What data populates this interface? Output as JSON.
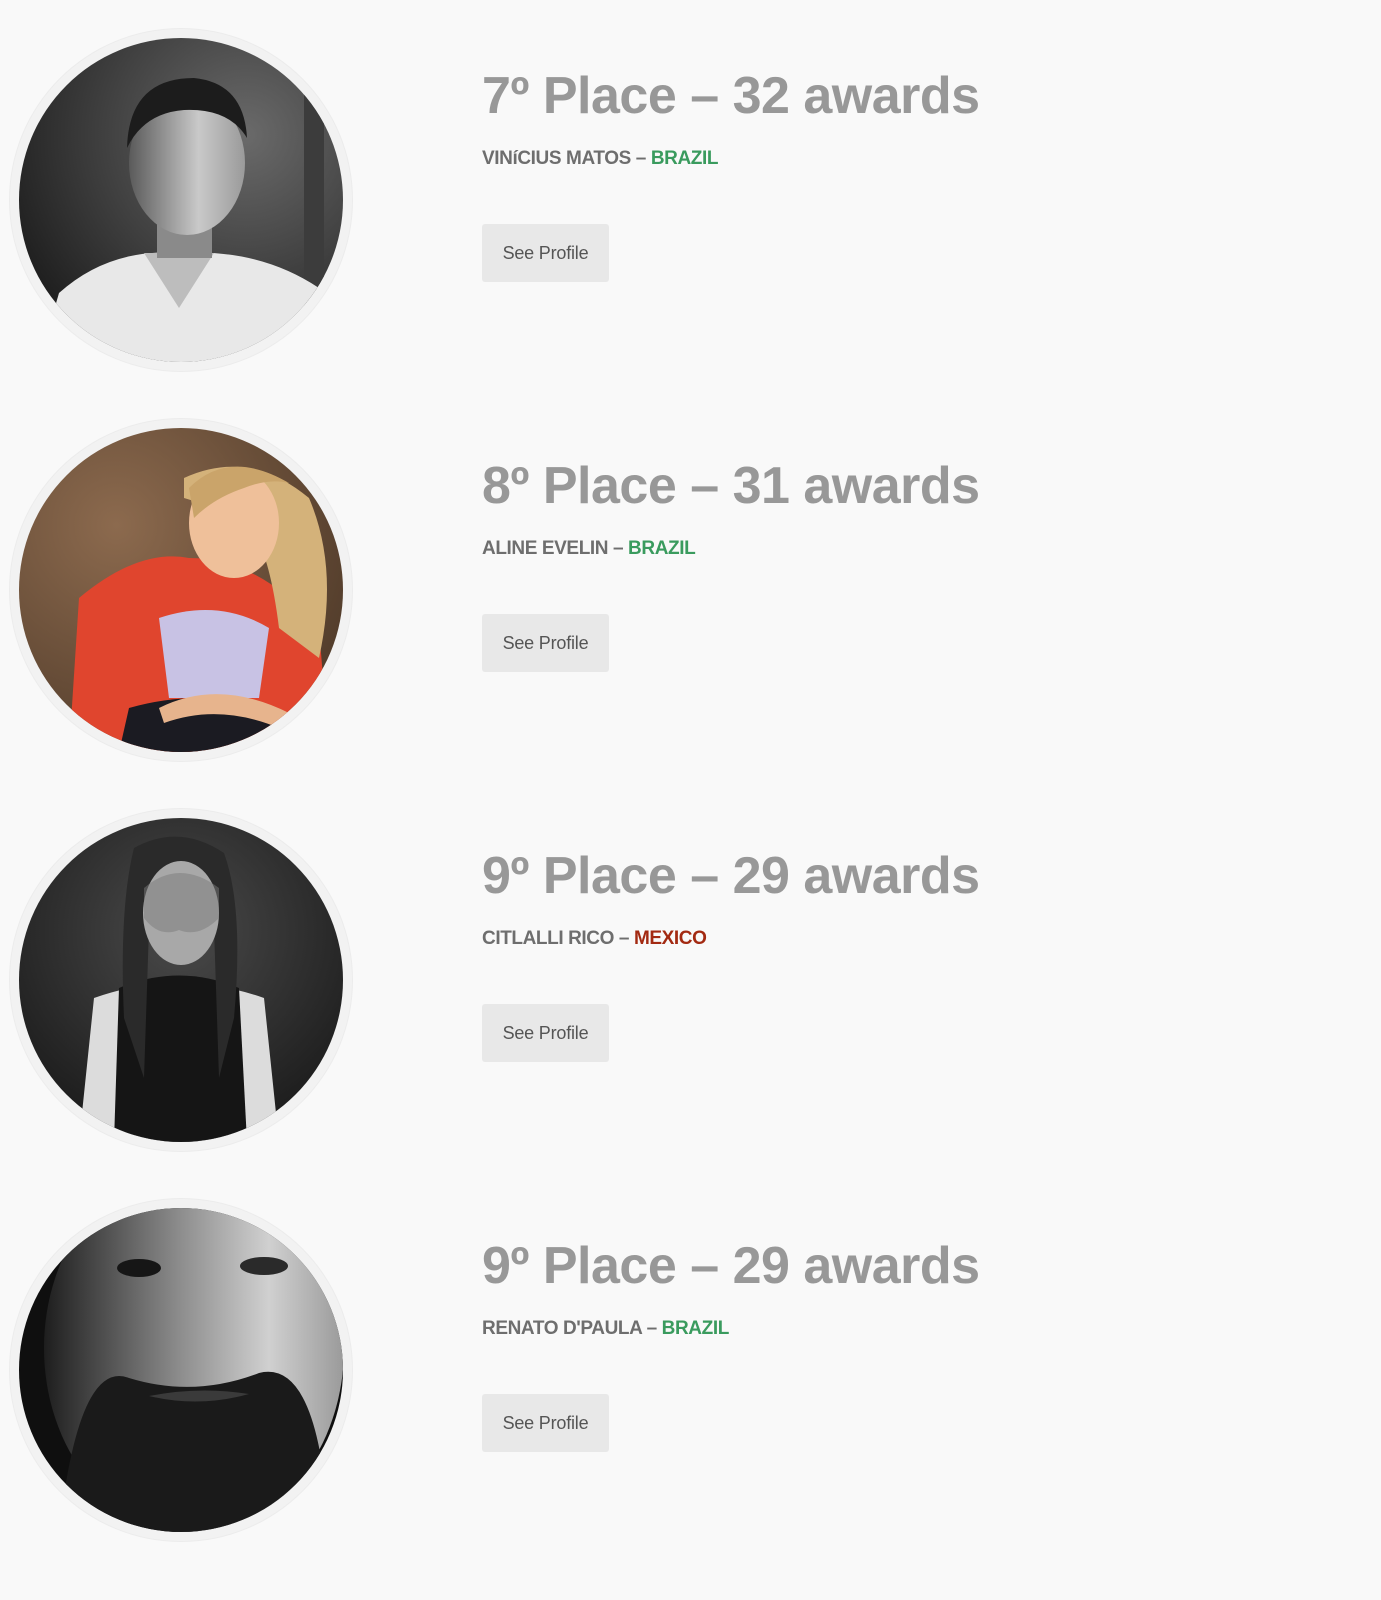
{
  "entries": [
    {
      "title": "7º Place – 32 awards",
      "name": "VINíCIUS MATOS",
      "separator": " – ",
      "country": "BRAZIL",
      "country_color": "#3a9b5e",
      "button_label": "See Profile"
    },
    {
      "title": "8º Place – 31 awards",
      "name": "ALINE EVELIN",
      "separator": " – ",
      "country": "BRAZIL",
      "country_color": "#3a9b5e",
      "button_label": "See Profile"
    },
    {
      "title": "9º Place – 29 awards",
      "name": "CITLALLI RICO",
      "separator": " – ",
      "country": "MEXICO",
      "country_color": "#a32a12",
      "button_label": "See Profile"
    },
    {
      "title": "9º Place – 29 awards",
      "name": "RENATO D'PAULA",
      "separator": " – ",
      "country": "BRAZIL",
      "country_color": "#3a9b5e",
      "button_label": "See Profile"
    }
  ]
}
